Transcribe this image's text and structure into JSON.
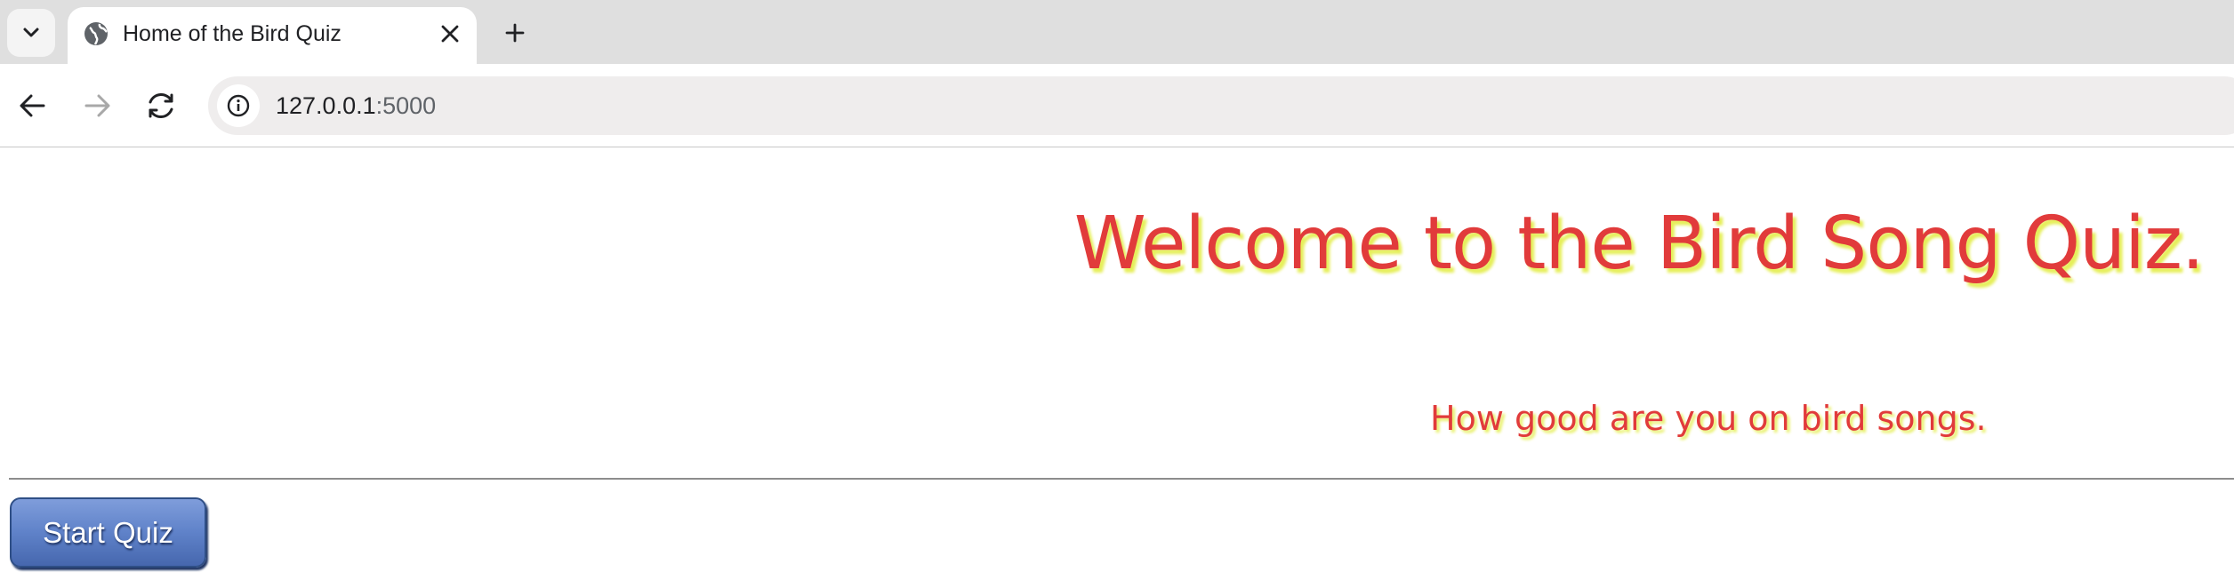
{
  "browser": {
    "tab": {
      "title": "Home of the Bird Quiz",
      "favicon": "globe-icon"
    },
    "address_bar": {
      "host": "127.0.0.1",
      "port": ":5000"
    },
    "icons": {
      "tab_search": "chevron-down-icon",
      "close_tab": "close-icon",
      "new_tab": "plus-icon",
      "back": "arrow-left-icon",
      "forward": "arrow-right-icon",
      "reload": "reload-icon",
      "site_info": "info-icon"
    }
  },
  "page": {
    "heading": "Welcome to the Bird Song Quiz.",
    "subheading": "How good are you on bird songs.",
    "start_button_label": "Start Quiz"
  },
  "colors": {
    "heading_text": "#e13b3b",
    "heading_shadow": "#e6ef5a",
    "button_blue": "#5f82c9",
    "tabstrip_bg": "#dfdfdf",
    "omnibox_bg": "#efeded"
  }
}
